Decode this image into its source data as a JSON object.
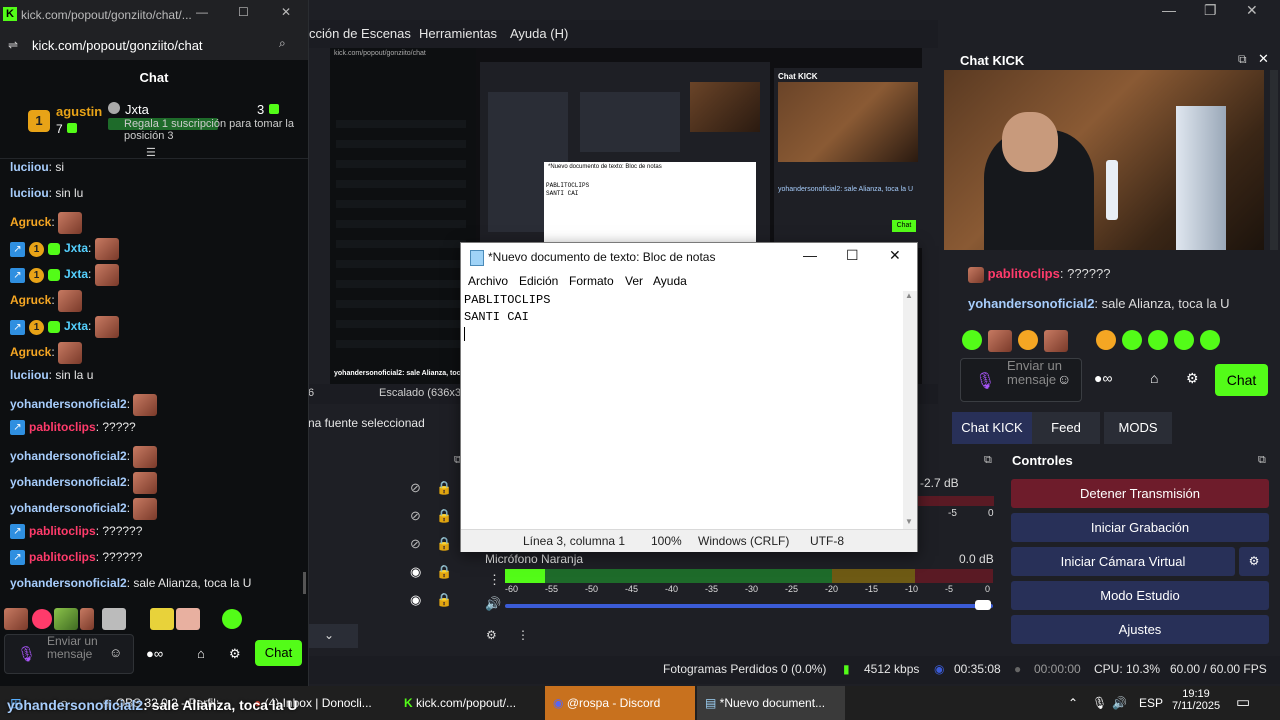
{
  "kick_window": {
    "title": "kick.com/popout/gonziito/chat/...",
    "url": "kick.com/popout/gonziito/chat",
    "header": "Chat",
    "pinned": {
      "user1": "agustin",
      "user1_count": "7",
      "user2": "Jxta",
      "user2_count": "3",
      "gift_text": "Regala 1 suscripción para tomar la posición 3"
    },
    "messages": [
      {
        "user": "luciiou",
        "text": "si"
      },
      {
        "user": "luciiou",
        "text": "sin lu"
      },
      {
        "user": "Agruck",
        "text": ""
      },
      {
        "user": "Jxta",
        "text": ""
      },
      {
        "user": "Jxta",
        "text": ""
      },
      {
        "user": "Agruck",
        "text": ""
      },
      {
        "user": "Jxta",
        "text": ""
      },
      {
        "user": "Agruck",
        "text": ""
      },
      {
        "user": "luciiou",
        "text": "sin la u"
      },
      {
        "user": "yohandersonoficial2",
        "text": ""
      },
      {
        "user": "pablitoclips",
        "text": "?????"
      },
      {
        "user": "yohandersonoficial2",
        "text": ""
      },
      {
        "user": "yohandersonoficial2",
        "text": ""
      },
      {
        "user": "yohandersonoficial2",
        "text": ""
      },
      {
        "user": "pablitoclips",
        "text": "??????"
      },
      {
        "user": "pablitoclips",
        "text": "??????"
      },
      {
        "user": "yohandersonoficial2",
        "text": "sale Alianza, toca la U"
      }
    ],
    "input_placeholder": "Enviar un mensaje",
    "chat_button": "Chat"
  },
  "obs": {
    "menu": [
      "cción de Escenas",
      "Herramientas",
      "Ayuda (H)"
    ],
    "preview_scaled": "Escalado (636x357)",
    "preview_num": "6",
    "source_hint": "na fuente seleccionad",
    "chat_dock_title": "Chat KICK",
    "dock_messages": [
      {
        "user": "pablitoclips",
        "text": "??????"
      },
      {
        "user": "yohandersonoficial2",
        "text": "sale Alianza, toca la U"
      }
    ],
    "dock_input_placeholder": "Enviar un mensaje",
    "dock_chat_button": "Chat",
    "tabs": [
      "Chat KICK",
      "Feed",
      "MODS"
    ],
    "controls_title": "Controles",
    "controls": [
      "Detener Transmisión",
      "Iniciar Grabación",
      "Iniciar Cámara Virtual",
      "Modo Estudio",
      "Ajustes"
    ],
    "mixer": {
      "db_top": "-2.7 dB",
      "mic_name": "Micrófono Naranja",
      "mic_db": "0.0 dB",
      "scale": [
        "-60",
        "-55",
        "-50",
        "-45",
        "-40",
        "-35",
        "-30",
        "-25",
        "-20",
        "-15",
        "-10",
        "-5",
        "0"
      ],
      "scale_top_right": [
        "-5",
        "0"
      ]
    },
    "status": {
      "dropped": "Fotogramas Perdidos 0 (0.0%)",
      "bitrate": "4512 kbps",
      "stream_time": "00:35:08",
      "rec_time": "00:00:00",
      "cpu": "CPU: 10.3%",
      "fps": "60.00 / 60.00 FPS"
    }
  },
  "notepad": {
    "title": "*Nuevo documento de texto: Bloc de notas",
    "menu": [
      "Archivo",
      "Edición",
      "Formato",
      "Ver",
      "Ayuda"
    ],
    "lines": [
      "PABLITOCLIPS",
      "SANTI CAI"
    ],
    "status": {
      "pos": "Línea 3, columna 1",
      "zoom": "100%",
      "eol": "Windows (CRLF)",
      "enc": "UTF-8"
    }
  },
  "preview_inner": {
    "url": "kick.com/popout/gonziito/chat",
    "notepad_title": "*Nuevo documento de texto: Bloc de notas",
    "np_lines": [
      "PABLITOCLIPS",
      "SANTI CAI"
    ],
    "chat_title": "Chat KICK",
    "dock_line": "yohandersonoficial2: sale Alianza, toca la U",
    "chat_button": "Chat",
    "overlay_line": "yohandersonoficial2: sale Alianza, toca la"
  },
  "overlay_caption": {
    "user": "yohandersonoficial2",
    "text": ": sale Alianza, toca la U"
  },
  "taskbar": {
    "items": [
      "OBS 32.0.2 - Perfil:",
      "(4) Inbox | Donocli...",
      "kick.com/popout/...",
      "@rospa - Discord",
      "*Nuevo document..."
    ],
    "lang": "ESP",
    "time": "19:19",
    "date": "7/11/2025"
  },
  "colors": {
    "kick_green": "#53fc18",
    "stop_red": "#6e1c2b",
    "control_blue": "#283058"
  }
}
